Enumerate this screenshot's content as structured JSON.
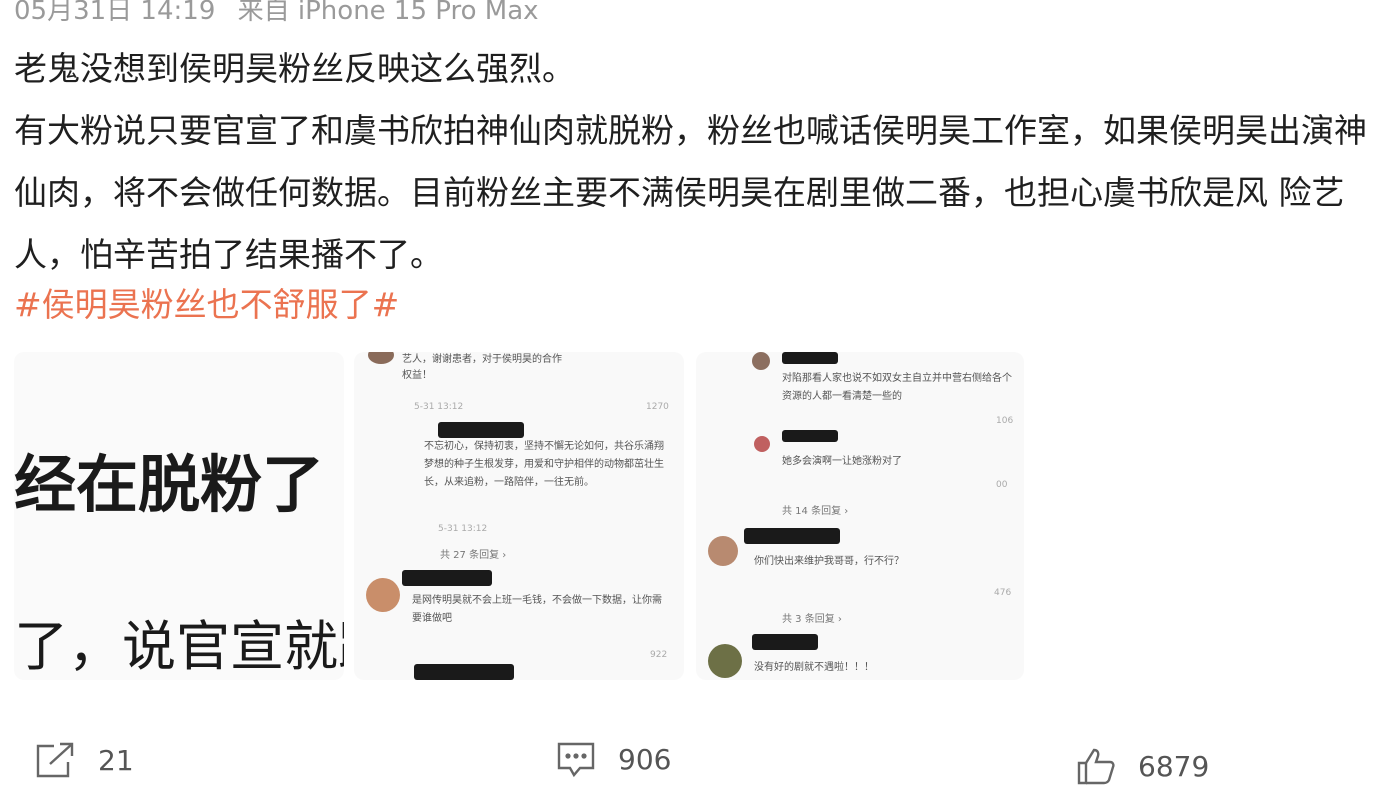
{
  "meta": {
    "date": "05月31日 14:19",
    "source": "来自 iPhone 15 Pro Max"
  },
  "post": {
    "lines": [
      "老鬼没想到侯明昊粉丝反映这么强烈。",
      "有大粉说只要官宣了和虞书欣拍神仙肉就脱粉，粉丝也喊话侯明昊工作室，如果侯明昊出演神仙肉，将不会做任何数据。目前粉丝主要不满侯明昊在剧里做二番，也担心虞书欣是风 险艺人，怕辛苦拍了结果播不了。"
    ],
    "hashtag": "#侯明昊粉丝也不舒服了#"
  },
  "images": {
    "image1": {
      "line1": "经在脱粉了",
      "line2": "了，说官宣就跟"
    },
    "image2": {
      "top_text": "艺人，谢谢患者，对于侯明昊的合作",
      "top_text2": "权益！",
      "top_meta": "5-31 13:12",
      "top_likes": "1270",
      "c1_text": "不忘初心，保持初衷，坚持不懈无论如何，共谷乐涌翔梦想的种子生根发芽，用爱和守护相伴的动物都茁壮生长，从来追粉，一路陪伴，一往无前。",
      "c1_meta": "5-31 13:12",
      "c1_replies": "共 27 条回复 ›",
      "c2_text": "是网传明昊就不会上班一毛钱，不会做一下数据，让你需要谁做吧",
      "c2_likes": "922"
    },
    "image3": {
      "c1_text": "对陷那看人家也说不如双女主自立并中营右侧给各个资源的人都一看清楚一些的",
      "c1_likes": "106",
      "c2_text": "她多会演啊一让她涨粉对了",
      "c2_likes": "00",
      "c2_replies": "共 14 条回复 ›",
      "c3_text": "你们快出来维护我哥哥，行不行？",
      "c3_likes": "476",
      "c3_replies": "共 3 条回复 ›",
      "c4_text": "没有好的剧就不遇啦！！！"
    }
  },
  "actions": {
    "share_count": "21",
    "comment_count": "906",
    "like_count": "6879"
  },
  "colors": {
    "hashtag": "#eb7350",
    "meta": "#9a9a9a",
    "text": "#1f1f1f"
  }
}
